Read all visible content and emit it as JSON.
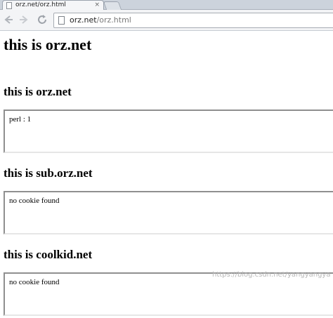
{
  "browser": {
    "tab_title": "orz.net/orz.html",
    "tab_close": "×",
    "url_host": "orz.net",
    "url_path": "/orz.html",
    "icons": {
      "back": "back-arrow-icon",
      "forward": "forward-arrow-icon",
      "reload": "reload-icon",
      "page": "page-icon"
    }
  },
  "page": {
    "main_heading": "this is orz.net",
    "sections": [
      {
        "heading": "this is orz.net",
        "frame_text": "perl : 1"
      },
      {
        "heading": "this is sub.orz.net",
        "frame_text": "no cookie found"
      },
      {
        "heading": "this is coolkid.net",
        "frame_text": "no cookie found"
      }
    ]
  },
  "watermark": "https://blog.csdn.net/yangyangya"
}
